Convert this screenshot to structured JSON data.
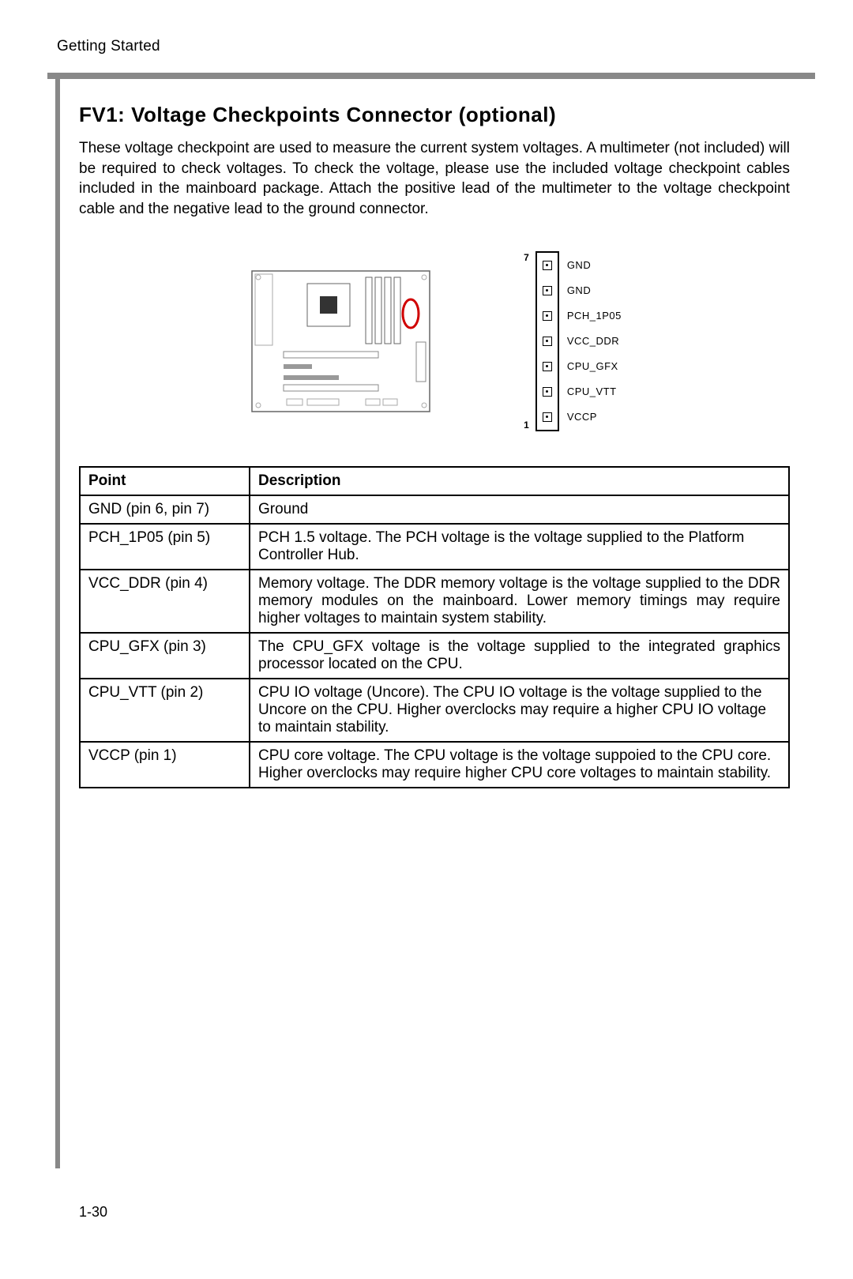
{
  "header": "Getting Started",
  "section": {
    "title": "FV1: Voltage Checkpoints Connector (optional)",
    "intro": "These voltage checkpoint are used to measure the current system voltages. A multimeter (not included) will be required to check voltages. To check the voltage, please use the included voltage checkpoint cables included in the mainboard package. Attach the positive lead of the multimeter to the voltage checkpoint cable and the negative lead to the ground connector."
  },
  "connector": {
    "top_num": "7",
    "bottom_num": "1",
    "pins": [
      "GND",
      "GND",
      "PCH_1P05",
      "VCC_DDR",
      "CPU_GFX",
      "CPU_VTT",
      "VCCP"
    ]
  },
  "table": {
    "headers": {
      "col1": "Point",
      "col2": "Description"
    },
    "rows": [
      {
        "point": "GND (pin 6, pin 7)",
        "desc": "Ground",
        "justify": false
      },
      {
        "point": "PCH_1P05 (pin 5)",
        "desc": "PCH 1.5 voltage. The PCH voltage is the voltage supplied to the Platform Controller Hub.",
        "justify": false
      },
      {
        "point": "VCC_DDR (pin 4)",
        "desc": "Memory voltage. The DDR memory voltage is the voltage supplied to the DDR memory modules on the mainboard. Lower memory timings may require higher voltages to maintain system stability.",
        "justify": true
      },
      {
        "point": "CPU_GFX (pin 3)",
        "desc": "The CPU_GFX voltage is the voltage supplied to the integrated graphics processor located on the CPU.",
        "justify": true
      },
      {
        "point": "CPU_VTT (pin 2)",
        "desc": "CPU IO voltage (Uncore). The CPU IO voltage is the voltage supplied to the Uncore on the CPU. Higher overclocks may require a higher CPU IO voltage to maintain stability.",
        "justify": false
      },
      {
        "point": "VCCP (pin 1)",
        "desc": "CPU core voltage. The CPU voltage is the voltage suppoied to the CPU core. Higher overclocks may require higher CPU core voltages to maintain stability.",
        "justify": false
      }
    ]
  },
  "footer": "1-30"
}
